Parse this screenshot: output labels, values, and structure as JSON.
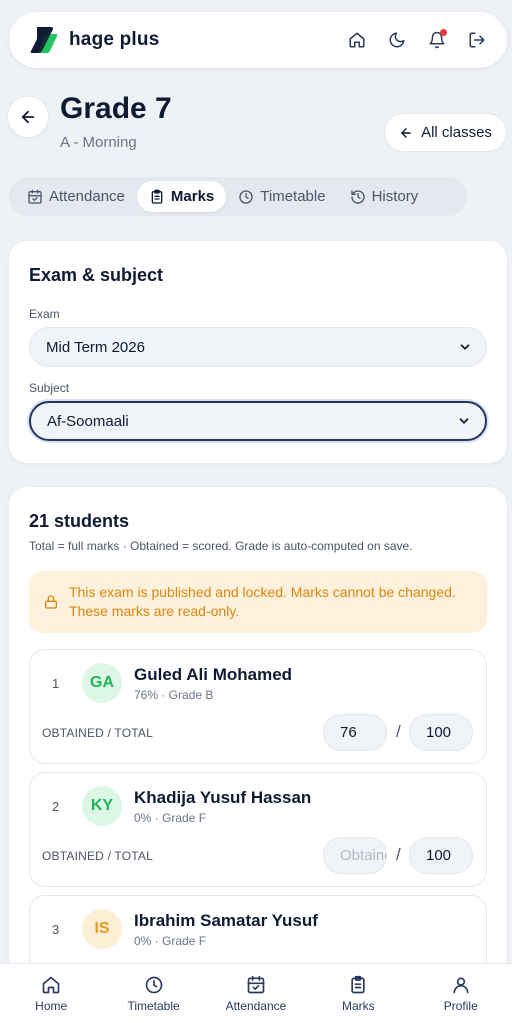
{
  "app": {
    "brand": "hage plus"
  },
  "colors": {
    "accent": "#0f1b33",
    "brand_green": "#22c55e",
    "warning_bg": "#fdf0dc",
    "warning_text": "#d9880e",
    "notif_dot": "#e53935"
  },
  "header": {
    "icons": [
      "home-icon",
      "moon-icon",
      "bell-icon",
      "logout-icon"
    ],
    "title": "Grade 7",
    "subtitle": "A - Morning",
    "all_classes_label": "All classes"
  },
  "tabs": [
    {
      "label": "Attendance",
      "icon": "calendar-check-icon",
      "active": false
    },
    {
      "label": "Marks",
      "icon": "clipboard-icon",
      "active": true
    },
    {
      "label": "Timetable",
      "icon": "clock-icon",
      "active": false
    },
    {
      "label": "History",
      "icon": "history-icon",
      "active": false
    }
  ],
  "exam_card": {
    "title": "Exam & subject",
    "exam_label": "Exam",
    "exam_value": "Mid Term 2026",
    "subject_label": "Subject",
    "subject_value": "Af-Soomaali"
  },
  "students_card": {
    "title": "21 students",
    "subtitle": "Total = full marks · Obtained = scored. Grade is auto-computed on save.",
    "lock_message": "This exam is published and locked. Marks cannot be changed. These marks are read-only.",
    "obtained_total_label": "OBTAINED / TOTAL",
    "obtained_placeholder": "Obtained",
    "students": [
      {
        "index": "1",
        "initials": "GA",
        "name": "Guled Ali Mohamed",
        "meta": "76% · Grade B",
        "obtained": "76",
        "total": "100",
        "avatar_bg": "#dcf7e6",
        "avatar_fg": "#22b35a"
      },
      {
        "index": "2",
        "initials": "KY",
        "name": "Khadija Yusuf Hassan",
        "meta": "0% · Grade F",
        "obtained": "",
        "total": "100",
        "avatar_bg": "#dcf7e6",
        "avatar_fg": "#22b35a"
      },
      {
        "index": "3",
        "initials": "IS",
        "name": "Ibrahim Samatar Yusuf",
        "meta": "0% · Grade F",
        "obtained": "",
        "total": "",
        "avatar_bg": "#fdeed6",
        "avatar_fg": "#e69a1c"
      }
    ]
  },
  "bottom_nav": [
    {
      "label": "Home",
      "icon": "home-icon"
    },
    {
      "label": "Timetable",
      "icon": "clock-icon"
    },
    {
      "label": "Attendance",
      "icon": "calendar-check-icon"
    },
    {
      "label": "Marks",
      "icon": "clipboard-icon"
    },
    {
      "label": "Profile",
      "icon": "user-icon"
    }
  ]
}
